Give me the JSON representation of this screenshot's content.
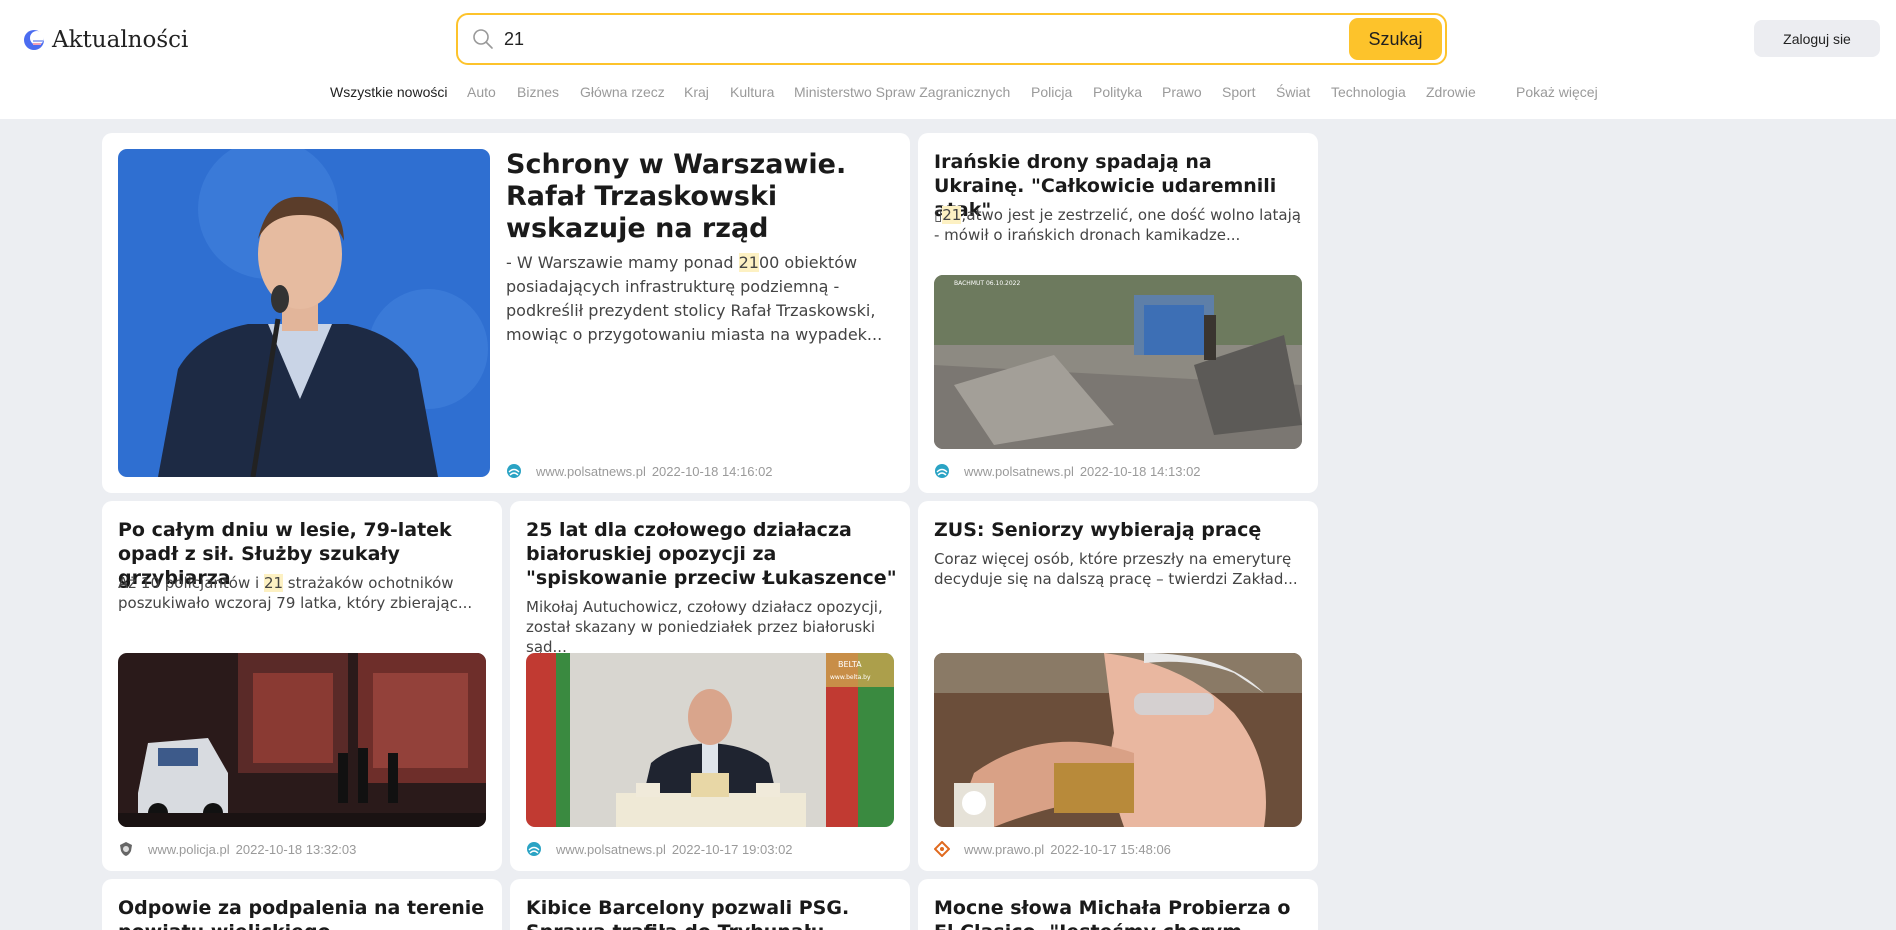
{
  "header": {
    "logo_text": "Aktualności",
    "search_value": "21",
    "search_button": "Szukaj",
    "login_button": "Zaloguj sie"
  },
  "nav": {
    "items": [
      "Wszystkie nowości",
      "Auto",
      "Biznes",
      "Główna rzecz",
      "Kraj",
      "Kultura",
      "Ministerstwo Spraw Zagranicznych",
      "Policja",
      "Polityka",
      "Prawo",
      "Sport",
      "Świat",
      "Technologia",
      "Zdrowie"
    ],
    "more": "Pokaż więcej"
  },
  "articles": [
    {
      "title": "Schrony w Warszawie. Rafał Trzaskowski wskazuje na rząd",
      "desc_before": "- W Warszawie mamy ponad ",
      "desc_hl": "21",
      "desc_after": "00 obiektów posiadających infrastrukturę podziemną - podkreślił prezydent stolicy Rafał Trzaskowski, mowiąc o przygotowaniu miasta na wypadek...",
      "source": "www.polsatnews.pl",
      "date": "2022-10-18 14:16:02",
      "icon": "polsatnews-icon"
    },
    {
      "title": "Irańskie drony spadają na Ukrainę. \"Całkowicie udaremnili atak\"",
      "desc_before": "▯",
      "desc_hl": "21",
      "desc_after": ";atwo jest je zestrzelić, one dość wolno latają - mówił o irańskich dronach kamikadze...",
      "source": "www.polsatnews.pl",
      "date": "2022-10-18 14:13:02",
      "icon": "polsatnews-icon"
    },
    {
      "title": "Po całym dniu w lesie, 79-latek opadł z sił. Służby szukały grzybiarza",
      "desc_before": "Aż 10 policjantów i ",
      "desc_hl": "21",
      "desc_after": " strażaków ochotników poszukiwało wczoraj 79 latka, który zbierając...",
      "source": "www.policja.pl",
      "date": "2022-10-18 13:32:03",
      "icon": "policja-icon"
    },
    {
      "title": "25 lat dla czołowego działacza białoruskiej opozycji za \"spiskowanie przeciw Łukaszence\"",
      "desc_before": "Mikołaj Autuchowicz, czołowy działacz opozycji, został skazany w poniedziałek przez białoruski sąd...",
      "desc_hl": "",
      "desc_after": "",
      "source": "www.polsatnews.pl",
      "date": "2022-10-17 19:03:02",
      "icon": "polsatnews-icon"
    },
    {
      "title": "ZUS: Seniorzy wybierają pracę",
      "desc_before": "Coraz więcej osób, które przeszły na emeryturę decyduje się na dalszą pracę – twierdzi Zakład...",
      "desc_hl": "",
      "desc_after": "",
      "source": "www.prawo.pl",
      "date": "2022-10-17 15:48:06",
      "icon": "prawo-icon"
    },
    {
      "title": "Odpowie za podpalenia na terenie powiatu wielickiego"
    },
    {
      "title": "Kibice Barcelony pozwali PSG. Sprawa trafiła do Trybunału Sprawiedliwości"
    },
    {
      "title": "Mocne słowa Michała Probierza o El Clasico. \"Jesteśmy chorym krajem\""
    }
  ],
  "image_labels": {
    "drone": "BACHMUT 06.10.2022",
    "belta": "BELTA",
    "belta_url": "www.belta.by"
  }
}
